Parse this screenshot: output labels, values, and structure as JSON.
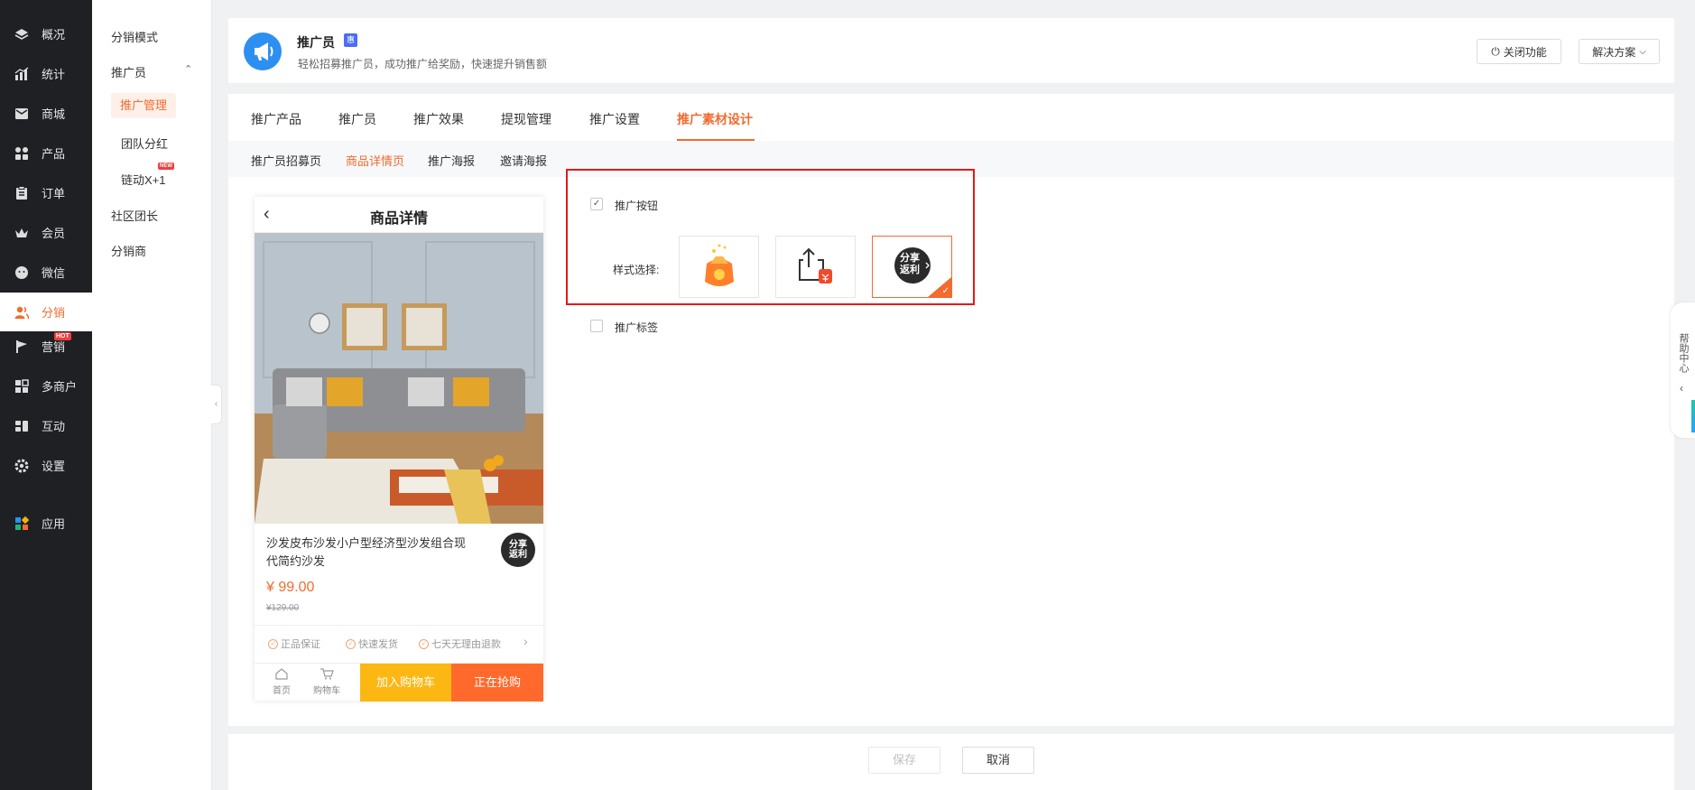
{
  "colors": {
    "accent": "#f26b2f",
    "sidebar_bg": "#1e2024",
    "highlight_box": "#e21a1a"
  },
  "nav": {
    "items": [
      {
        "label": "概况",
        "icon": "layers-icon"
      },
      {
        "label": "统计",
        "icon": "chart-icon"
      },
      {
        "label": "商城",
        "icon": "mail-icon"
      },
      {
        "label": "产品",
        "icon": "grid-icon"
      },
      {
        "label": "订单",
        "icon": "clipboard-icon"
      },
      {
        "label": "会员",
        "icon": "crown-icon"
      },
      {
        "label": "微信",
        "icon": "wechat-icon"
      },
      {
        "label": "分销",
        "icon": "users-icon"
      },
      {
        "label": "营销",
        "icon": "flag-icon",
        "badge": "HOT"
      },
      {
        "label": "多商户",
        "icon": "store-icon"
      },
      {
        "label": "互动",
        "icon": "blocks-icon"
      },
      {
        "label": "设置",
        "icon": "gear-icon"
      },
      {
        "label": "应用",
        "icon": "apps-icon"
      }
    ]
  },
  "subnav": {
    "mode": "分销模式",
    "promoter": "推广员",
    "promo_manage": "推广管理",
    "team_bonus": "团队分红",
    "chain": "链动X+1",
    "chain_badge": "NEW",
    "community": "社区团长",
    "distributor": "分销商"
  },
  "header": {
    "title": "推广员",
    "badge": "惠",
    "subtitle": "轻松招募推广员，成功推广给奖励，快速提升销售额",
    "close_btn": "关闭功能",
    "solution_btn": "解决方案"
  },
  "tabs": [
    "推广产品",
    "推广员",
    "推广效果",
    "提现管理",
    "推广设置",
    "推广素材设计"
  ],
  "subtabs": [
    "推广员招募页",
    "商品详情页",
    "推广海报",
    "邀请海报"
  ],
  "phone": {
    "title": "商品详情",
    "product_name": "沙发皮布沙发小户型经济型沙发组合现代简约沙发",
    "share": "分享返利",
    "price": "¥ 99.00",
    "original_price": "¥129.00",
    "guarantees": [
      "正品保证",
      "快速发货",
      "七天无理由退款"
    ],
    "footer": {
      "home": "首页",
      "cart": "购物车",
      "add_cart": "加入购物车",
      "buy_now": "正在抢购"
    }
  },
  "settings": {
    "promo_button_label": "推广按钮",
    "promo_button_checked": true,
    "style_label": "样式选择:",
    "styles": [
      "bag-icon",
      "share-upload-icon",
      "share-rebate-icon"
    ],
    "style_share_text": "分享返利",
    "promo_tag_label": "推广标签",
    "promo_tag_checked": false
  },
  "footer": {
    "save": "保存",
    "cancel": "取消"
  },
  "help": {
    "label": "帮助中心"
  }
}
